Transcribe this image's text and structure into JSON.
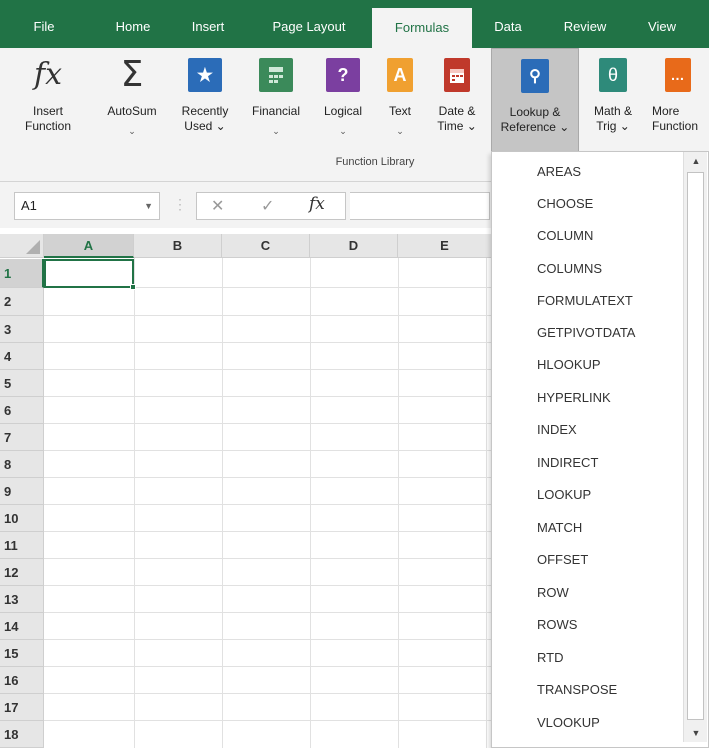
{
  "tabs": [
    "File",
    "Home",
    "Insert",
    "Page Layout",
    "Formulas",
    "Data",
    "Review",
    "View"
  ],
  "active_tab": "Formulas",
  "ribbon": {
    "buttons": [
      {
        "icon": "fx-icon",
        "line1": "Insert",
        "line2": "Function",
        "chevron": ""
      },
      {
        "icon": "sigma-icon",
        "line1": "AutoSum",
        "line2": "",
        "chevron": "⌄"
      },
      {
        "icon": "star-book-icon",
        "line1": "Recently",
        "line2": "Used ⌄",
        "chevron": ""
      },
      {
        "icon": "calculator-book-icon",
        "line1": "Financial",
        "line2": "",
        "chevron": "⌄"
      },
      {
        "icon": "question-book-icon",
        "line1": "Logical",
        "line2": "",
        "chevron": "⌄"
      },
      {
        "icon": "text-book-icon",
        "line1": "Text",
        "line2": "",
        "chevron": "⌄"
      },
      {
        "icon": "calendar-book-icon",
        "line1": "Date &",
        "line2": "Time ⌄",
        "chevron": ""
      },
      {
        "icon": "search-book-icon",
        "line1": "Lookup &",
        "line2": "Reference ⌄",
        "chevron": ""
      },
      {
        "icon": "theta-book-icon",
        "line1": "Math &",
        "line2": "Trig ⌄",
        "chevron": ""
      },
      {
        "icon": "more-book-icon",
        "line1": "More",
        "line2": "Function",
        "chevron": ""
      }
    ],
    "icon_glyphs": {
      "fx": "fx",
      "sigma": "Σ",
      "star": "★",
      "question": "?",
      "text": "A",
      "search": "⚲",
      "theta": "θ",
      "more": "…"
    },
    "group_label": "Function Library"
  },
  "formula_bar": {
    "name_box": "A1",
    "cancel": "✕",
    "enter": "✓",
    "fx": "fx"
  },
  "grid": {
    "columns": [
      "A",
      "B",
      "C",
      "D",
      "E"
    ],
    "rows": [
      "1",
      "2",
      "3",
      "4",
      "5",
      "6",
      "7",
      "8",
      "9",
      "10",
      "11",
      "12",
      "13",
      "14",
      "15",
      "16",
      "17",
      "18"
    ],
    "selected_cell": "A1"
  },
  "lookup_menu": {
    "items": [
      "AREAS",
      "CHOOSE",
      "COLUMN",
      "COLUMNS",
      "FORMULATEXT",
      "GETPIVOTDATA",
      "HLOOKUP",
      "HYPERLINK",
      "INDEX",
      "INDIRECT",
      "LOOKUP",
      "MATCH",
      "OFFSET",
      "ROW",
      "ROWS",
      "RTD",
      "TRANSPOSE",
      "VLOOKUP"
    ]
  },
  "colors": {
    "excel_green": "#217346",
    "ribbon_bg": "#f3f3f3",
    "book_blue": "#2b6cb8",
    "book_green": "#3b8a5a",
    "book_purple": "#7b3fa0",
    "book_orange": "#f0a030",
    "book_red": "#c0392b",
    "book_teal": "#2e8a7a",
    "book_orange_more": "#e86a1a"
  }
}
